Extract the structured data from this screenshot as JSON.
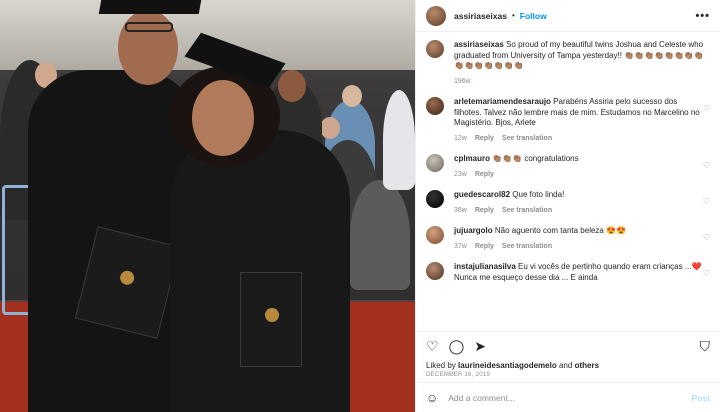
{
  "header": {
    "username": "assiriaseixas",
    "separator": "•",
    "follow_label": "Follow",
    "more_icon": "more-icon"
  },
  "caption": {
    "username": "assiriaseixas",
    "text": "So proud of my beautiful twins Joshua and Celeste who graduated from University of Tampa yesterday!! 👏🏽👏🏽👏🏽👏🏽👏🏽👏🏽👏🏽👏🏽👏🏽👏🏽👏🏽👏🏽👏🏽👏🏽👏🏽",
    "time": "196w"
  },
  "comments": [
    {
      "username": "arletemariamendesaraujo",
      "text": "Parabéns Assiria pelo sucesso dos filhotes. Talvez não lembre mais de mim. Estudamos no Marcelino no Magistério. Bjos, Arlete",
      "time": "12w",
      "reply": "Reply",
      "see_translation": "See translation"
    },
    {
      "username": "cplmauro",
      "text": "👏🏽👏🏽👏🏽 congratulations",
      "time": "23w",
      "reply": "Reply",
      "see_translation": ""
    },
    {
      "username": "guedescarol82",
      "text": "Que foto linda!",
      "time": "36w",
      "reply": "Reply",
      "see_translation": "See translation"
    },
    {
      "username": "jujuargolo",
      "text": "Não aguento com tanta beleza 😍😍",
      "time": "37w",
      "reply": "Reply",
      "see_translation": "See translation"
    },
    {
      "username": "instajulianasilva",
      "text": "Eu vi vocês de pertinho quando eram crianças ...❤️ Nunca me esqueço desse dia ... E ainda",
      "time": "",
      "reply": "",
      "see_translation": ""
    }
  ],
  "likes": {
    "prefix": "Liked by",
    "user": "laurineidesantiagodemelo",
    "and": "and",
    "others": "others"
  },
  "date": "DECEMBER 16, 2019",
  "add_comment": {
    "placeholder": "Add a comment...",
    "post_label": "Post"
  },
  "icons": {
    "like": "heart-icon",
    "comment": "comment-icon",
    "share": "share-icon",
    "save": "bookmark-icon",
    "emoji": "emoji-icon"
  },
  "colors": {
    "link": "#0095f6",
    "muted": "#8e8e8e",
    "gown": "#141414",
    "floor": "#a3301f"
  }
}
